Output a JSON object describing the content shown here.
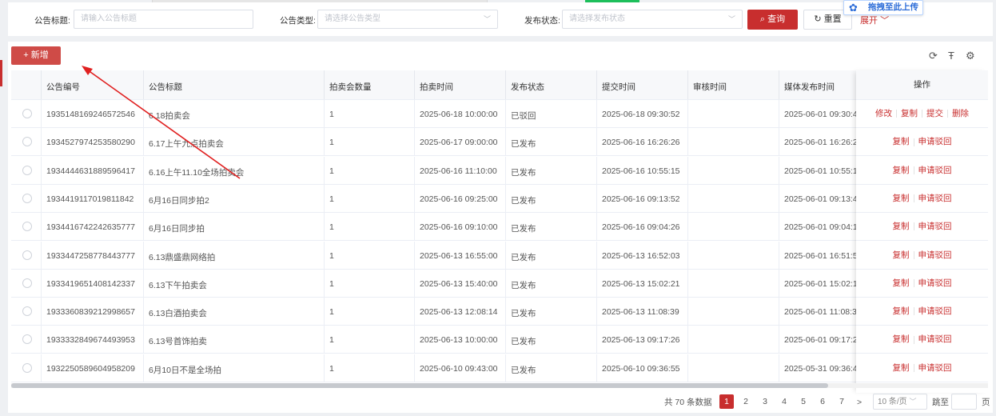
{
  "search": {
    "title_label": "公告标题:",
    "title_placeholder": "请输入公告标题",
    "type_label": "公告类型:",
    "type_placeholder": "请选择公告类型",
    "status_label": "发布状态:",
    "status_placeholder": "请选择发布状态",
    "query_label": "查询",
    "reset_label": "重置",
    "expand_label": "展开"
  },
  "upload_badge": "拖拽至此上传",
  "toolbar": {
    "add_label": "+ 新增"
  },
  "table": {
    "columns": [
      "公告编号",
      "公告标题",
      "拍卖会数量",
      "拍卖时间",
      "发布状态",
      "提交时间",
      "审核时间",
      "媒体发布时间",
      "操作"
    ],
    "rows": [
      {
        "id": "1935148169246572546",
        "title": "6.18拍卖会",
        "count": "1",
        "auction_time": "2025-06-18 10:00:00",
        "status": "已驳回",
        "submit_time": "2025-06-18 09:30:52",
        "review_time": "",
        "media_time": "2025-06-01 09:30:4",
        "ops": [
          "修改",
          "复制",
          "提交",
          "删除"
        ]
      },
      {
        "id": "1934527974253580290",
        "title": "6.17上午九点拍卖会",
        "count": "1",
        "auction_time": "2025-06-17 09:00:00",
        "status": "已发布",
        "submit_time": "2025-06-16 16:26:26",
        "review_time": "",
        "media_time": "2025-06-01 16:26:2",
        "ops": [
          "复制",
          "申请驳回"
        ]
      },
      {
        "id": "1934444631889596417",
        "title": "6.16上午11.10全场拍卖会",
        "count": "1",
        "auction_time": "2025-06-16 11:10:00",
        "status": "已发布",
        "submit_time": "2025-06-16 10:55:15",
        "review_time": "",
        "media_time": "2025-06-01 10:55:1",
        "ops": [
          "复制",
          "申请驳回"
        ]
      },
      {
        "id": "1934419117019811842",
        "title": "6月16日同步拍2",
        "count": "1",
        "auction_time": "2025-06-16 09:25:00",
        "status": "已发布",
        "submit_time": "2025-06-16 09:13:52",
        "review_time": "",
        "media_time": "2025-06-01 09:13:4",
        "ops": [
          "复制",
          "申请驳回"
        ]
      },
      {
        "id": "1934416742242635777",
        "title": "6月16日同步拍",
        "count": "1",
        "auction_time": "2025-06-16 09:10:00",
        "status": "已发布",
        "submit_time": "2025-06-16 09:04:26",
        "review_time": "",
        "media_time": "2025-06-01 09:04:1",
        "ops": [
          "复制",
          "申请驳回"
        ]
      },
      {
        "id": "1933447258778443777",
        "title": "6.13鼎盛鼎网络拍",
        "count": "1",
        "auction_time": "2025-06-13 16:55:00",
        "status": "已发布",
        "submit_time": "2025-06-13 16:52:03",
        "review_time": "",
        "media_time": "2025-06-01 16:51:5",
        "ops": [
          "复制",
          "申请驳回"
        ]
      },
      {
        "id": "1933419651408142337",
        "title": "6.13下午拍卖会",
        "count": "1",
        "auction_time": "2025-06-13 15:40:00",
        "status": "已发布",
        "submit_time": "2025-06-13 15:02:21",
        "review_time": "",
        "media_time": "2025-06-01 15:02:1",
        "ops": [
          "复制",
          "申请驳回"
        ]
      },
      {
        "id": "1933360839212998657",
        "title": "6.13白酒拍卖会",
        "count": "1",
        "auction_time": "2025-06-13 12:08:14",
        "status": "已发布",
        "submit_time": "2025-06-13 11:08:39",
        "review_time": "",
        "media_time": "2025-06-01 11:08:3",
        "ops": [
          "复制",
          "申请驳回"
        ]
      },
      {
        "id": "1933332849674493953",
        "title": "6.13号首饰拍卖",
        "count": "1",
        "auction_time": "2025-06-13 10:00:00",
        "status": "已发布",
        "submit_time": "2025-06-13 09:17:26",
        "review_time": "",
        "media_time": "2025-06-01 09:17:2",
        "ops": [
          "复制",
          "申请驳回"
        ]
      },
      {
        "id": "1932250589604958209",
        "title": "6月10日不是全场拍",
        "count": "1",
        "auction_time": "2025-06-10 09:43:00",
        "status": "已发布",
        "submit_time": "2025-06-10 09:36:55",
        "review_time": "",
        "media_time": "2025-05-31 09:36:4",
        "ops": [
          "复制",
          "申请驳回"
        ]
      }
    ]
  },
  "pagination": {
    "total_text": "共 70 条数据",
    "pages": [
      "1",
      "2",
      "3",
      "4",
      "5",
      "6",
      "7"
    ],
    "current": "1",
    "next": ">",
    "page_size": "10 条/页",
    "goto_label": "跳至",
    "page_suffix": "页"
  },
  "colors": {
    "primary": "#c82e2e",
    "add_button": "#cf4b47",
    "annotation_arrow": "#e02020"
  },
  "icons": [
    "refresh-icon",
    "column-height-icon",
    "settings-icon",
    "search-icon",
    "reset-icon",
    "chevron-down-icon",
    "upload-icon",
    "plus-icon"
  ]
}
